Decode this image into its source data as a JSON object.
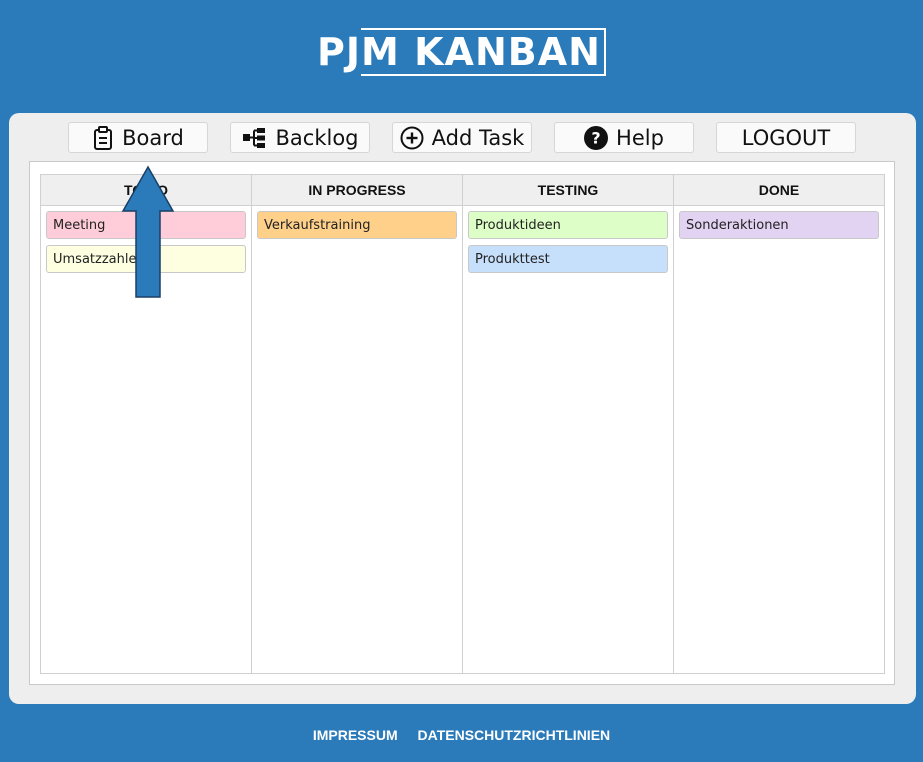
{
  "logo": {
    "prefix": "PJ",
    "boxed": "M KANBAN"
  },
  "nav": {
    "board": "Board",
    "backlog": "Backlog",
    "add_task": "Add Task",
    "help": "Help",
    "logout": "LOGOUT"
  },
  "columns": [
    {
      "title": "TO DO",
      "cards": [
        {
          "label": "Meeting",
          "color": "#ffcdd9"
        },
        {
          "label": "Umsatzzahlen",
          "color": "#fefee0"
        }
      ]
    },
    {
      "title": "IN PROGRESS",
      "cards": [
        {
          "label": "Verkaufstraining",
          "color": "#ffd08a"
        }
      ]
    },
    {
      "title": "TESTING",
      "cards": [
        {
          "label": "Produktideen",
          "color": "#ddffc7"
        },
        {
          "label": "Produkttest",
          "color": "#c6dffb"
        }
      ]
    },
    {
      "title": "DONE",
      "cards": [
        {
          "label": "Sonderaktionen",
          "color": "#e2d3f3"
        }
      ]
    }
  ],
  "footer": {
    "impressum": "IMPRESSUM",
    "privacy": "DATENSCHUTZRICHTLINIEN"
  },
  "colors": {
    "background": "#2b7bba",
    "arrow": "#2b7bba"
  }
}
